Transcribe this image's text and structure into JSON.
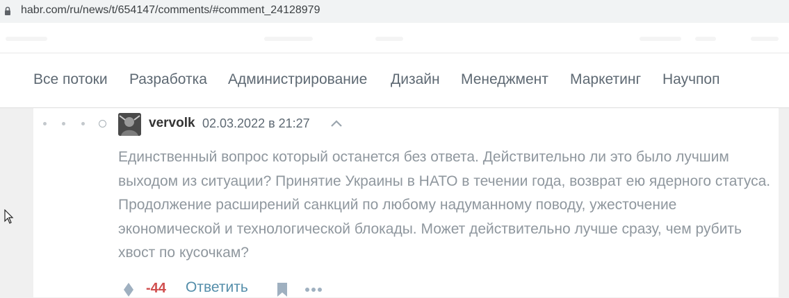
{
  "browser": {
    "url": "habr.com/ru/news/t/654147/comments/#comment_24128979"
  },
  "nav": {
    "items": [
      "Все потоки",
      "Разработка",
      "Администрирование",
      "Дизайн",
      "Менеджмент",
      "Маркетинг",
      "Научпоп"
    ]
  },
  "comment": {
    "author": "vervolk",
    "date": "02.03.2022 в 21:27",
    "text": "Единственный вопрос который останется без ответа. Действительно ли это было лучшим выходом из ситуации? Принятие Украины в НАТО в течении года, возврат ею ядерного статуса. Продолжение расширений санкций по любому надуманному поводу, ужесточение экономической и технологической блокады. Может действительно лучше сразу, чем рубить хвост по кусочкам?",
    "score": "-44",
    "reply_label": "Ответить"
  },
  "icons": {
    "lock": "lock-icon",
    "parent": "arrow-up-icon",
    "vote": "vote-icon",
    "bookmark": "bookmark-icon",
    "more": "more-icon"
  },
  "colors": {
    "score_negative": "#d04e4e",
    "link": "#548eaa",
    "comment_text": "#8f979e"
  }
}
